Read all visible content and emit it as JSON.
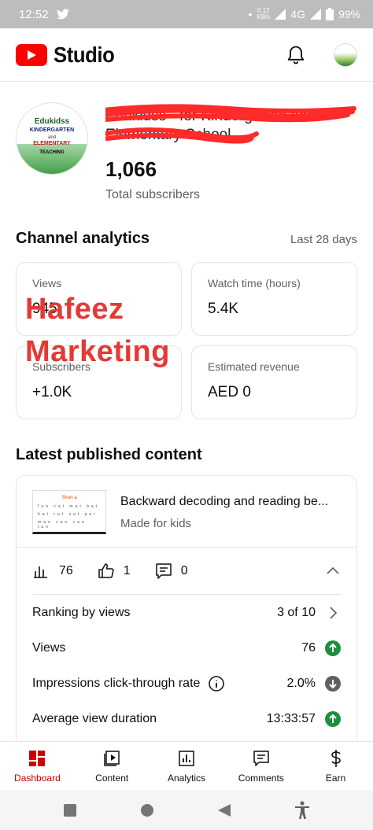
{
  "status_bar": {
    "time": "12:52",
    "data_rate_top": "0.12",
    "data_rate_bottom": "KB/s",
    "network": "4G",
    "battery": "99%"
  },
  "app": {
    "title": "Studio",
    "colors": {
      "accent": "#cc0000",
      "brand_red": "#ff0000",
      "positive": "#1e8e3e",
      "neutral": "#606060"
    }
  },
  "channel": {
    "name_line1": "Edukidss - for Kindergarten and",
    "name_line2": "Elementary School",
    "subscribers": "1,066",
    "subscribers_label": "Total subscribers",
    "avatar_text": {
      "line1": "Edukidss",
      "line2": "KINDERGARTEN",
      "line3": "and",
      "line4": "ELEMENTARY",
      "line5": "TEACHING"
    }
  },
  "analytics": {
    "title": "Channel analytics",
    "range": "Last 28 days",
    "cards": [
      {
        "label": "Views",
        "value": "945"
      },
      {
        "label": "Watch time (hours)",
        "value": "5.4K"
      },
      {
        "label": "Subscribers",
        "value": "+1.0K"
      },
      {
        "label": "Estimated revenue",
        "value": "AED 0"
      }
    ]
  },
  "watermark": {
    "line1": "Hafeez",
    "line2": "Marketing"
  },
  "latest": {
    "title": "Latest published content",
    "video": {
      "title": "Backward decoding and reading be...",
      "subtitle": "Made for kids",
      "thumb_title": "Short a",
      "thumb_rows": [
        "fan cat mat bat",
        "hat rat sat pat",
        "man can van tan"
      ]
    },
    "stats": {
      "views": "76",
      "likes": "1",
      "comments": "0"
    },
    "metrics": [
      {
        "label": "Ranking by views",
        "value": "3 of 10"
      },
      {
        "label": "Views",
        "value": "76",
        "trend": "up"
      },
      {
        "label": "Impressions click-through rate",
        "value": "2.0%",
        "trend": "down"
      },
      {
        "label": "Average view duration",
        "value": "13:33:57",
        "trend": "up"
      }
    ]
  },
  "bottom_nav": [
    {
      "label": "Dashboard",
      "icon": "dashboard-icon",
      "active": true
    },
    {
      "label": "Content",
      "icon": "content-icon"
    },
    {
      "label": "Analytics",
      "icon": "analytics-icon"
    },
    {
      "label": "Comments",
      "icon": "comments-icon"
    },
    {
      "label": "Earn",
      "icon": "dollar-icon"
    }
  ]
}
